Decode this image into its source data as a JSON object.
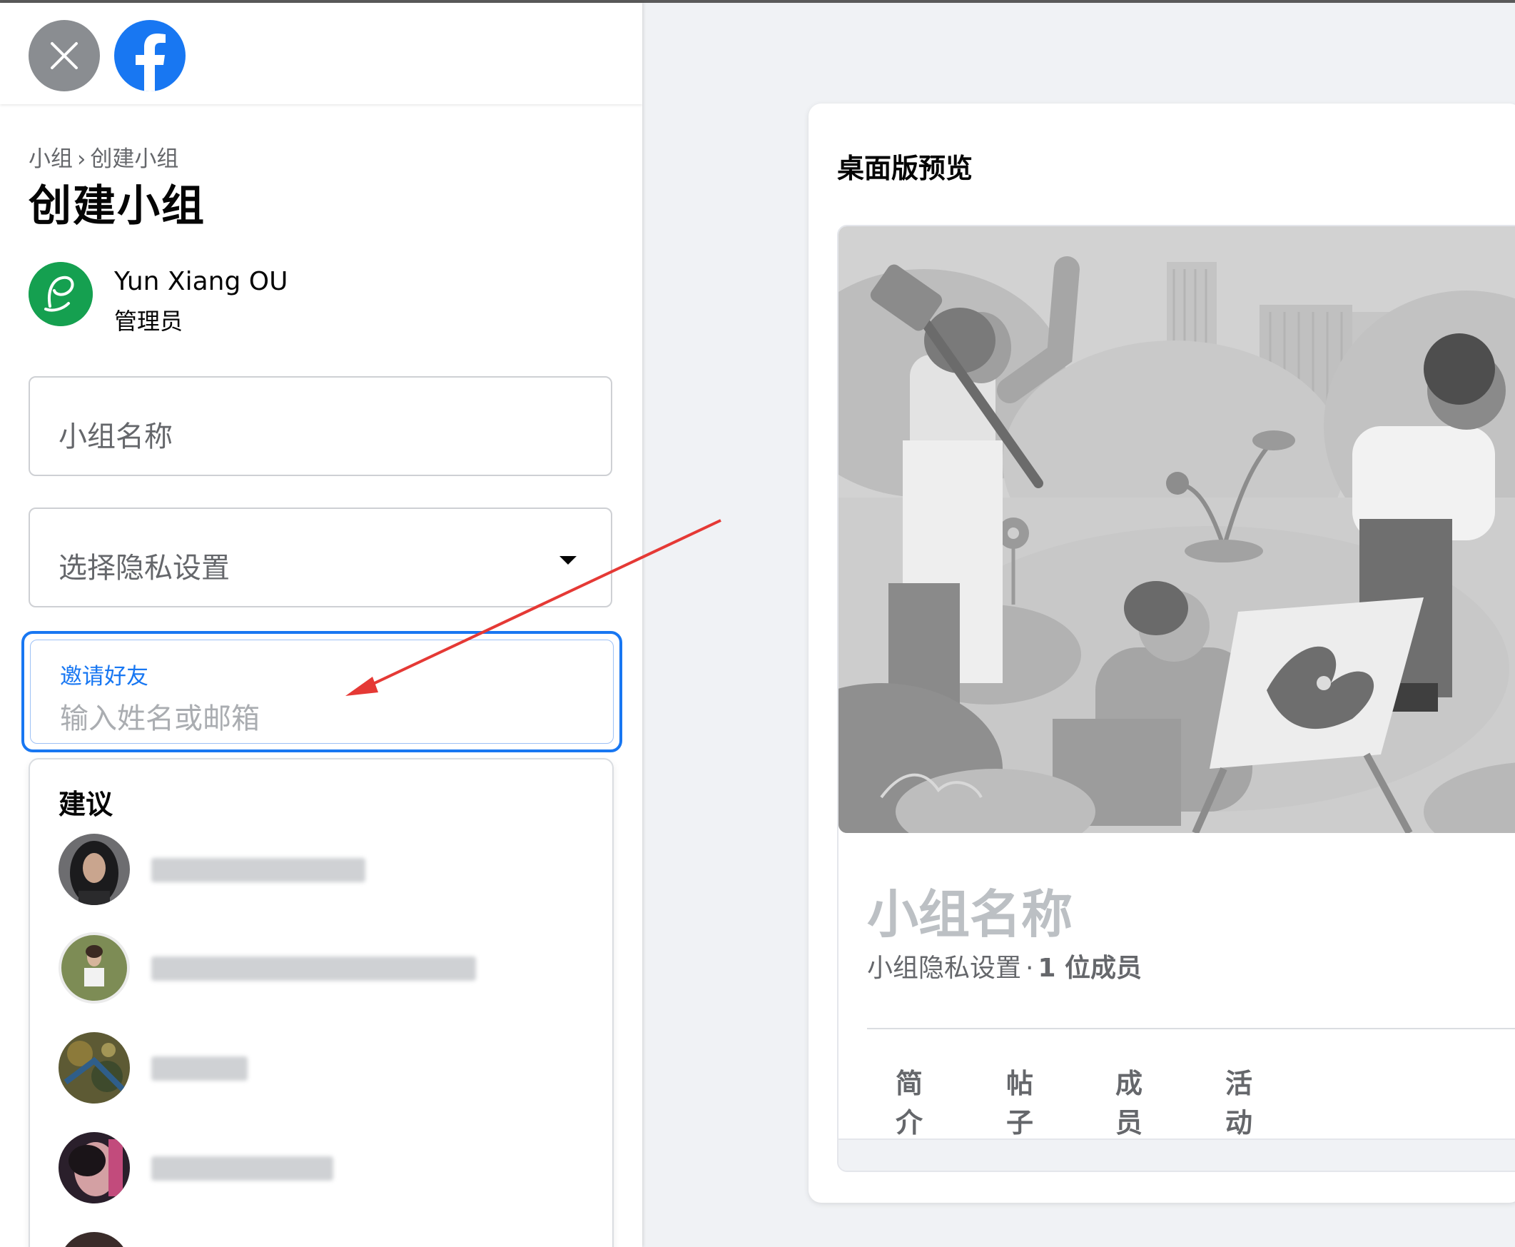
{
  "header": {
    "close_icon": "close-icon",
    "logo_icon": "facebook-logo-icon"
  },
  "breadcrumb": {
    "parent": "小组",
    "separator": "›",
    "current": "创建小组"
  },
  "page_title": "创建小组",
  "admin": {
    "name": "Yun Xiang OU",
    "role": "管理员"
  },
  "form": {
    "group_name_placeholder": "小组名称",
    "privacy_placeholder": "选择隐私设置",
    "invite_label": "邀请好友",
    "invite_placeholder": "输入姓名或邮箱"
  },
  "suggestions": {
    "title": "建议",
    "items": [
      {
        "name": "████ ██████"
      },
      {
        "name": "█████ ███████████"
      },
      {
        "name": "██████"
      },
      {
        "name": "████ ██████"
      }
    ]
  },
  "preview": {
    "title": "桌面版预览",
    "group_name": "小组名称",
    "privacy_text": "小组隐私设置",
    "meta_separator": "·",
    "member_count": "1 位成员",
    "tabs": [
      "简介",
      "帖子",
      "成员",
      "活动"
    ]
  },
  "colors": {
    "accent": "#1877f2",
    "annotation_arrow": "#e53935",
    "admin_avatar": "#15a050"
  }
}
